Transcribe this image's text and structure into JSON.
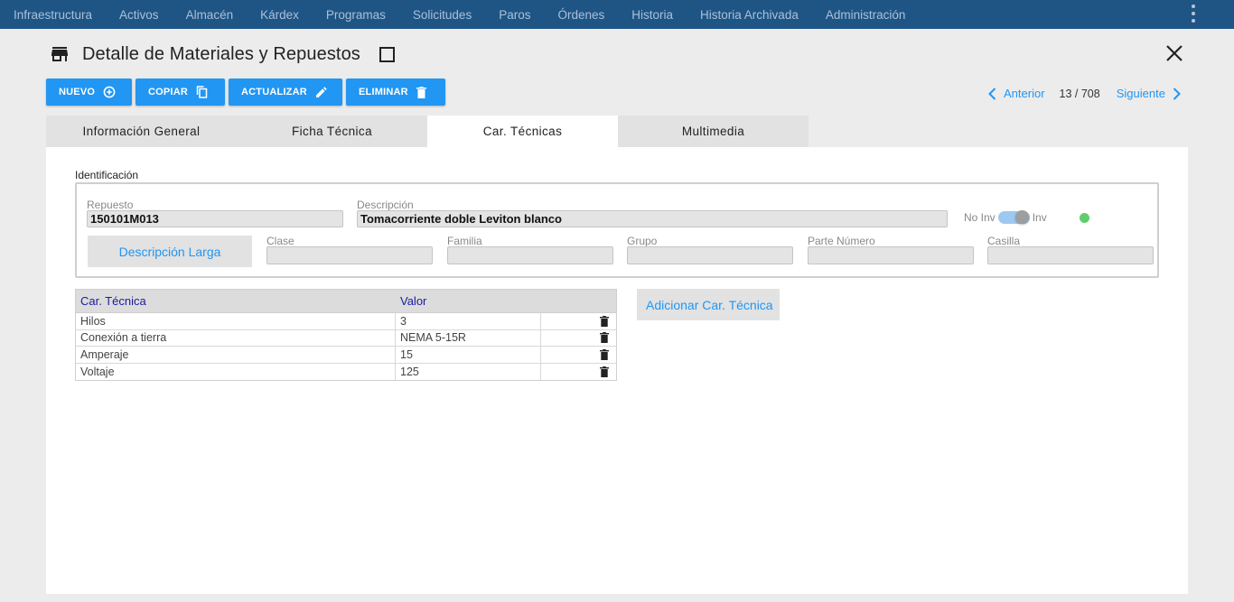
{
  "nav": {
    "items": [
      "Infraestructura",
      "Activos",
      "Almacén",
      "Kárdex",
      "Programas",
      "Solicitudes",
      "Paros",
      "Órdenes",
      "Historia",
      "Historia Archivada",
      "Administración"
    ]
  },
  "header": {
    "title": "Detalle de Materiales y Repuestos"
  },
  "toolbar": {
    "nuevo": "NUEVO",
    "copiar": "COPIAR",
    "actualizar": "ACTUALIZAR",
    "eliminar": "ELIMINAR"
  },
  "pager": {
    "prev": "Anterior",
    "count": "13 / 708",
    "next": "Siguiente"
  },
  "tabs": [
    "Información General",
    "Ficha Técnica",
    "Car. Técnicas",
    "Multimedia"
  ],
  "active_tab": "Car. Técnicas",
  "identificacion": {
    "section_label": "Identificación",
    "repuesto_label": "Repuesto",
    "repuesto_value": "150101M013",
    "descripcion_label": "Descripción",
    "descripcion_value": "Tomacorriente doble Leviton blanco",
    "no_inv_label": "No Inv",
    "inv_label": "Inv",
    "desc_larga_button": "Descripción Larga",
    "clase_label": "Clase",
    "clase_value": "",
    "familia_label": "Familia",
    "familia_value": "",
    "grupo_label": "Grupo",
    "grupo_value": "",
    "parte_numero_label": "Parte Número",
    "parte_numero_value": "",
    "casilla_label": "Casilla",
    "casilla_value": ""
  },
  "caracteristicas": {
    "headers": [
      "Car. Técnica",
      "Valor"
    ],
    "rows": [
      {
        "car": "Hilos",
        "valor": "3"
      },
      {
        "car": "Conexión a tierra",
        "valor": "NEMA 5-15R"
      },
      {
        "car": "Amperaje",
        "valor": "15"
      },
      {
        "car": "Voltaje",
        "valor": "125"
      }
    ],
    "add_button": "Adicionar Car. Técnica"
  },
  "colors": {
    "nav_bg": "#1f5585",
    "primary": "#2196f3",
    "status_ok": "#5fce6a"
  }
}
